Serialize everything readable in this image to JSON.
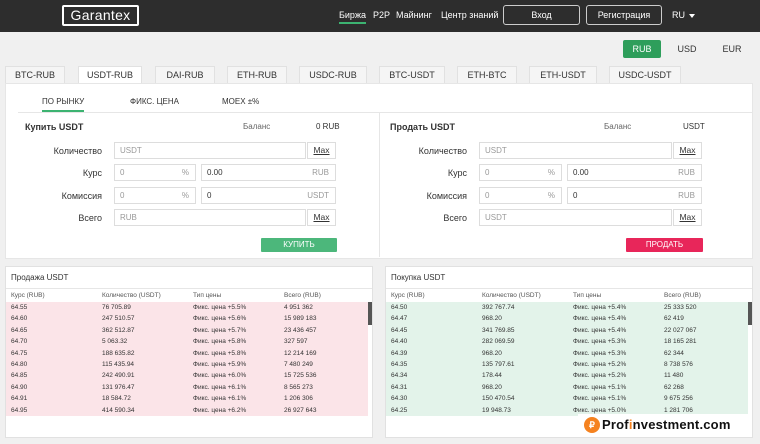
{
  "header": {
    "logo": "Garantex",
    "nav": [
      {
        "label": "Биржа",
        "active": true
      },
      {
        "label": "P2P"
      },
      {
        "label": "Майнинг"
      },
      {
        "label": "Центр знаний"
      }
    ],
    "login": "Вход",
    "register": "Регистрация",
    "language": "RU"
  },
  "currency": [
    "RUB",
    "USD",
    "EUR"
  ],
  "pairs": [
    "BTC-RUB",
    "USDT-RUB",
    "DAI-RUB",
    "ETH-RUB",
    "USDC-RUB",
    "BTC-USDT",
    "ETH-BTC",
    "ETH-USDT",
    "USDC-USDT"
  ],
  "order_tabs": [
    "ПО РЫНКУ",
    "ФИКС. ЦЕНА",
    "MOEX ±%"
  ],
  "buy": {
    "title": "Купить USDT",
    "balance_label": "Баланс",
    "balance_value": "0 RUB",
    "qty_label": "Количество",
    "qty_placeholder": "USDT",
    "rate_label": "Курс",
    "rate_pct": "0",
    "rate_value": "0.00",
    "rate_unit": "RUB",
    "fee_label": "Комиссия",
    "fee_pct": "0",
    "fee_value": "0",
    "fee_unit": "USDT",
    "total_label": "Всего",
    "total_placeholder": "RUB",
    "max": "Max",
    "button": "КУПИТЬ"
  },
  "sell": {
    "title": "Продать USDT",
    "balance_label": "Баланс",
    "balance_value": "USDT",
    "qty_label": "Количество",
    "qty_placeholder": "USDT",
    "rate_label": "Курс",
    "rate_pct": "0",
    "rate_value": "0.00",
    "rate_unit": "RUB",
    "fee_label": "Комиссия",
    "fee_pct": "0",
    "fee_value": "0",
    "fee_unit": "RUB",
    "total_label": "Всего",
    "total_placeholder": "USDT",
    "max": "Max",
    "button": "ПРОДАТЬ"
  },
  "asks": {
    "title": "Продажа USDT",
    "headers": [
      "Курс (RUB)",
      "Количество (USDT)",
      "Тип цены",
      "Всего (RUB)"
    ],
    "rows": [
      [
        "64.55",
        "76 705.89",
        "Фикс. цена +5.5%",
        "4 951 362"
      ],
      [
        "64.60",
        "247 510.57",
        "Фикс. цена +5.6%",
        "15 989 183"
      ],
      [
        "64.65",
        "362 512.87",
        "Фикс. цена +5.7%",
        "23 436 457"
      ],
      [
        "64.70",
        "5 063.32",
        "Фикс. цена +5.8%",
        "327 597"
      ],
      [
        "64.75",
        "188 635.82",
        "Фикс. цена +5.8%",
        "12 214 169"
      ],
      [
        "64.80",
        "115 435.94",
        "Фикс. цена +5.9%",
        "7 480 249"
      ],
      [
        "64.85",
        "242 490.91",
        "Фикс. цена +6.0%",
        "15 725 536"
      ],
      [
        "64.90",
        "131 976.47",
        "Фикс. цена +6.1%",
        "8 565 273"
      ],
      [
        "64.91",
        "18 584.72",
        "Фикс. цена +6.1%",
        "1 206 306"
      ],
      [
        "64.95",
        "414 590.34",
        "Фикс. цена +6.2%",
        "26 927 643"
      ]
    ]
  },
  "bids": {
    "title": "Покупка USDT",
    "headers": [
      "Курс (RUB)",
      "Количество (USDT)",
      "Тип цены",
      "Всего (RUB)"
    ],
    "rows": [
      [
        "64.50",
        "392 767.74",
        "Фикс. цена +5.4%",
        "25 333 520"
      ],
      [
        "64.47",
        "968.20",
        "Фикс. цена +5.4%",
        "62 419"
      ],
      [
        "64.45",
        "341 769.85",
        "Фикс. цена +5.4%",
        "22 027 067"
      ],
      [
        "64.40",
        "282 069.59",
        "Фикс. цена +5.3%",
        "18 165 281"
      ],
      [
        "64.39",
        "968.20",
        "Фикс. цена +5.3%",
        "62 344"
      ],
      [
        "64.35",
        "135 797.61",
        "Фикс. цена +5.2%",
        "8 738 576"
      ],
      [
        "64.34",
        "178.44",
        "Фикс. цена +5.2%",
        "11 480"
      ],
      [
        "64.31",
        "968.20",
        "Фикс. цена +5.1%",
        "62 268"
      ],
      [
        "64.30",
        "150 470.54",
        "Фикс. цена +5.1%",
        "9 675 256"
      ],
      [
        "64.25",
        "19 948.73",
        "Фикс. цена +5.0%",
        "1 281 706"
      ]
    ]
  },
  "watermark": {
    "prefix": "Prof",
    "accent": "i",
    "suffix": "nvestment.com"
  },
  "colors": {
    "accent_green": "#2e9e5b",
    "sell_red": "#e8265a",
    "ask_row": "#fbe4e8",
    "bid_row": "#e3f3ea"
  }
}
